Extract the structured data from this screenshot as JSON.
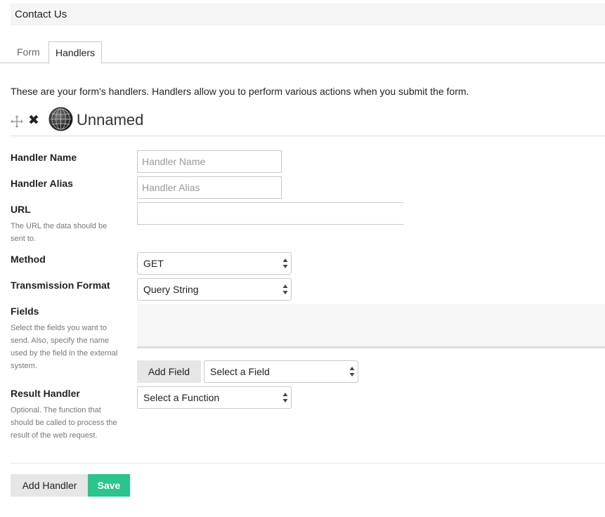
{
  "page": {
    "title": "Contact Us"
  },
  "tabs": [
    {
      "label": "Form",
      "active": false
    },
    {
      "label": "Handlers",
      "active": true
    }
  ],
  "intro_text": "These are your form's handlers. Handlers allow you to perform various actions when you submit the form.",
  "handler": {
    "name": "Unnamed",
    "icons": {
      "move": "move-icon",
      "remove": "close-icon",
      "type": "globe-icon"
    }
  },
  "form": {
    "handler_name": {
      "label": "Handler Name",
      "placeholder": "Handler Name",
      "value": ""
    },
    "handler_alias": {
      "label": "Handler Alias",
      "placeholder": "Handler Alias",
      "value": ""
    },
    "url": {
      "label": "URL",
      "help": "The URL the data should be sent to.",
      "value": ""
    },
    "method": {
      "label": "Method",
      "selected": "GET"
    },
    "transmission_format": {
      "label": "Transmission Format",
      "selected": "Query String"
    },
    "fields": {
      "label": "Fields",
      "help": "Select the fields you want to send. Also, specify the name used by the field in the external system.",
      "add_button": "Add Field",
      "select_placeholder": "Select a Field"
    },
    "result_handler": {
      "label": "Result Handler",
      "help": "Optional. The function that should be called to process the result of the web request.",
      "selected": "Select a Function"
    }
  },
  "footer": {
    "add_handler_label": "Add Handler",
    "save_label": "Save"
  },
  "colors": {
    "save_green": "#2bc48a",
    "button_grey": "#e6e6e6"
  }
}
